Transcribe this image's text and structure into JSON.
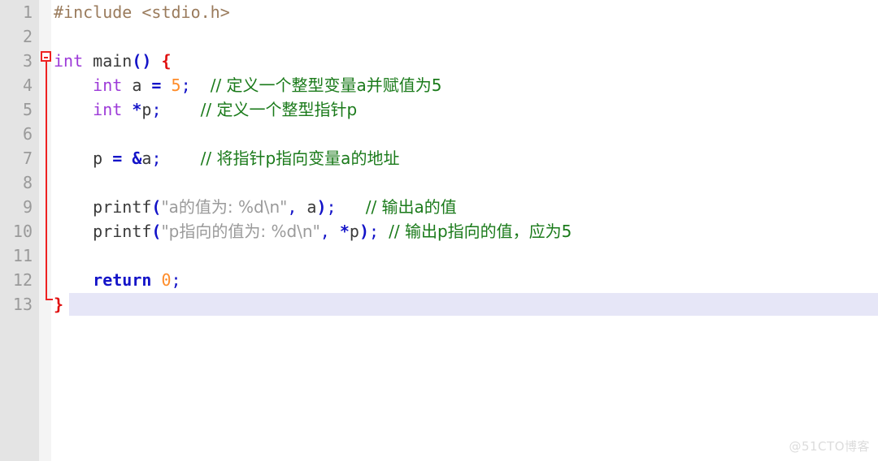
{
  "editor": {
    "language": "C",
    "total_lines": 13,
    "current_line": 13,
    "line_numbers": [
      "1",
      "2",
      "3",
      "4",
      "5",
      "6",
      "7",
      "8",
      "9",
      "10",
      "11",
      "12",
      "13"
    ],
    "fold_marker": "collapse-fold-minus",
    "colors": {
      "gutter_bg": "#e4e4e4",
      "fold_col_bg": "#f4f4f4",
      "code_bg": "#ffffff",
      "line_number": "#9a9a9a",
      "current_line_highlight": "#e6e6f7",
      "fold_line": "#ee2222",
      "preprocessor": "#9a7b5c",
      "keyword": "#9d3bd8",
      "keyword_return": "#1414c8",
      "operator": "#1414c8",
      "brace": "#e01010",
      "number": "#ff8c29",
      "string": "#9a9a9a",
      "comment": "#1a7a1a",
      "identifier": "#3a3a3a"
    }
  },
  "code_lines": [
    {
      "number": "1",
      "tokens": [
        {
          "text": "#include <stdio.h>",
          "cls": "t-pre"
        }
      ]
    },
    {
      "number": "2",
      "tokens": []
    },
    {
      "number": "3",
      "tokens": [
        {
          "text": "int",
          "cls": "t-kw"
        },
        {
          "text": " ",
          "cls": "t-id"
        },
        {
          "text": "main",
          "cls": "t-fn"
        },
        {
          "text": "()",
          "cls": "t-op"
        },
        {
          "text": " ",
          "cls": "t-id"
        },
        {
          "text": "{",
          "cls": "t-brace"
        }
      ]
    },
    {
      "number": "4",
      "tokens": [
        {
          "text": "    ",
          "cls": "t-id"
        },
        {
          "text": "int",
          "cls": "t-kw"
        },
        {
          "text": " a ",
          "cls": "t-id"
        },
        {
          "text": "=",
          "cls": "t-op"
        },
        {
          "text": " ",
          "cls": "t-id"
        },
        {
          "text": "5",
          "cls": "t-num"
        },
        {
          "text": ";",
          "cls": "t-punc"
        },
        {
          "text": "  ",
          "cls": "t-id"
        },
        {
          "text": "// 定义一个整型变量a并赋值为5",
          "cls": "t-com"
        }
      ]
    },
    {
      "number": "5",
      "tokens": [
        {
          "text": "    ",
          "cls": "t-id"
        },
        {
          "text": "int",
          "cls": "t-kw"
        },
        {
          "text": " ",
          "cls": "t-id"
        },
        {
          "text": "*",
          "cls": "t-op"
        },
        {
          "text": "p",
          "cls": "t-id"
        },
        {
          "text": ";",
          "cls": "t-punc"
        },
        {
          "text": "    ",
          "cls": "t-id"
        },
        {
          "text": "// 定义一个整型指针p",
          "cls": "t-com"
        }
      ]
    },
    {
      "number": "6",
      "tokens": []
    },
    {
      "number": "7",
      "tokens": [
        {
          "text": "    p ",
          "cls": "t-id"
        },
        {
          "text": "=",
          "cls": "t-op"
        },
        {
          "text": " ",
          "cls": "t-id"
        },
        {
          "text": "&",
          "cls": "t-op"
        },
        {
          "text": "a",
          "cls": "t-id"
        },
        {
          "text": ";",
          "cls": "t-punc"
        },
        {
          "text": "    ",
          "cls": "t-id"
        },
        {
          "text": "// 将指针p指向变量a的地址",
          "cls": "t-com"
        }
      ]
    },
    {
      "number": "8",
      "tokens": []
    },
    {
      "number": "9",
      "tokens": [
        {
          "text": "    ",
          "cls": "t-id"
        },
        {
          "text": "printf",
          "cls": "t-fn"
        },
        {
          "text": "(",
          "cls": "t-op"
        },
        {
          "text": "\"a的值为: %d\\n\"",
          "cls": "t-str"
        },
        {
          "text": ",",
          "cls": "t-punc"
        },
        {
          "text": " a",
          "cls": "t-id"
        },
        {
          "text": ")",
          "cls": "t-op"
        },
        {
          "text": ";",
          "cls": "t-punc"
        },
        {
          "text": "   ",
          "cls": "t-id"
        },
        {
          "text": "// 输出a的值",
          "cls": "t-com"
        }
      ]
    },
    {
      "number": "10",
      "tokens": [
        {
          "text": "    ",
          "cls": "t-id"
        },
        {
          "text": "printf",
          "cls": "t-fn"
        },
        {
          "text": "(",
          "cls": "t-op"
        },
        {
          "text": "\"p指向的值为: %d\\n\"",
          "cls": "t-str"
        },
        {
          "text": ",",
          "cls": "t-punc"
        },
        {
          "text": " ",
          "cls": "t-id"
        },
        {
          "text": "*",
          "cls": "t-op"
        },
        {
          "text": "p",
          "cls": "t-id"
        },
        {
          "text": ")",
          "cls": "t-op"
        },
        {
          "text": ";",
          "cls": "t-punc"
        },
        {
          "text": " ",
          "cls": "t-id"
        },
        {
          "text": "// 输出p指向的值，应为5",
          "cls": "t-com"
        }
      ]
    },
    {
      "number": "11",
      "tokens": []
    },
    {
      "number": "12",
      "tokens": [
        {
          "text": "    ",
          "cls": "t-id"
        },
        {
          "text": "return",
          "cls": "t-ret"
        },
        {
          "text": " ",
          "cls": "t-id"
        },
        {
          "text": "0",
          "cls": "t-num"
        },
        {
          "text": ";",
          "cls": "t-punc"
        }
      ]
    },
    {
      "number": "13",
      "current": true,
      "tokens": [
        {
          "text": "}",
          "cls": "t-brace"
        }
      ]
    }
  ],
  "watermark": {
    "text": "@51CTO博客"
  }
}
